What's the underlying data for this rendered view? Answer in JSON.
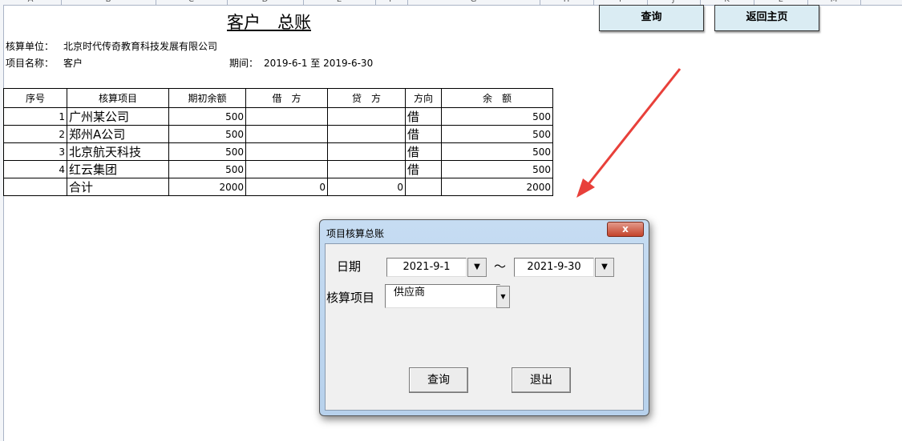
{
  "columns": [
    "A",
    "B",
    "C",
    "D",
    "E",
    "F",
    "G",
    "H",
    "I",
    "J",
    "K",
    "L",
    "M"
  ],
  "title": "客户　总账",
  "unit_label": "核算单位：",
  "unit_value": "北京时代传奇教育科技发展有限公司",
  "project_label": "项目名称：",
  "project_value": "客户",
  "period_label": "期间：",
  "period_value": "2019-6-1 至 2019-6-30",
  "buttons": {
    "query": "查询",
    "home": "返回主页"
  },
  "table": {
    "headers": [
      "序号",
      "核算项目",
      "期初余额",
      "借　方",
      "贷　方",
      "方向",
      "余　额"
    ],
    "rows": [
      [
        "1",
        "广州某公司",
        "500",
        "",
        "",
        "借",
        "500"
      ],
      [
        "2",
        "郑州A公司",
        "500",
        "",
        "",
        "借",
        "500"
      ],
      [
        "3",
        "北京航天科技",
        "500",
        "",
        "",
        "借",
        "500"
      ],
      [
        "4",
        "红云集团",
        "500",
        "",
        "",
        "借",
        "500"
      ],
      [
        "",
        "合计",
        "2000",
        "0",
        "0",
        "",
        "2000"
      ]
    ]
  },
  "dialog": {
    "title": "项目核算总账",
    "close": "x",
    "date_label": "日期",
    "date_from": "2021-9-1",
    "date_sep": "～",
    "date_to": "2021-9-30",
    "item_label": "核算项目",
    "item_value": "供应商",
    "query": "查询",
    "exit": "退出"
  }
}
